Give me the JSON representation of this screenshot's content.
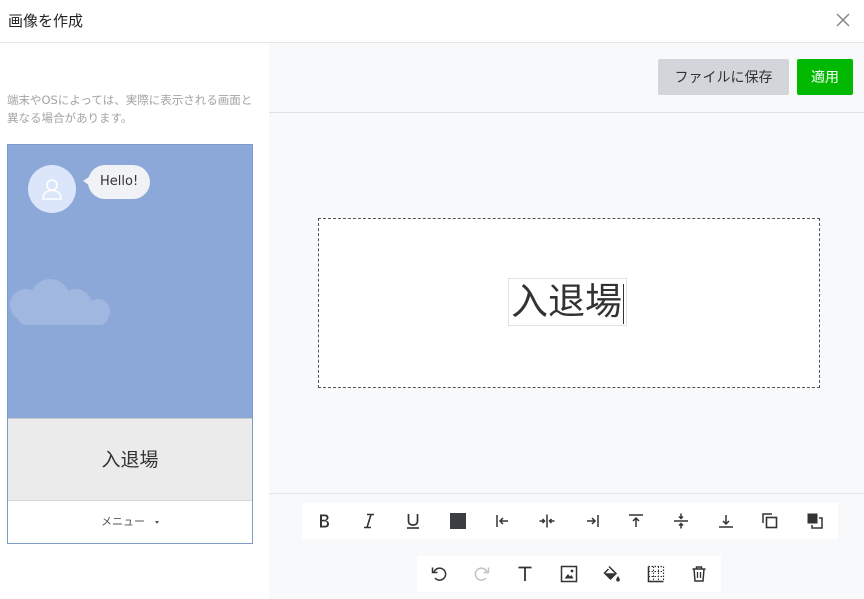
{
  "dialog": {
    "title": "画像を作成"
  },
  "preview": {
    "notice": "端末やOSによっては、実際に表示される画面と異なる場合があります。",
    "bubble_text": "Hello!",
    "richmenu_label": "入退場",
    "menu_label": "メニュー"
  },
  "actions": {
    "save_label": "ファイルに保存",
    "apply_label": "適用"
  },
  "editor": {
    "text": "入退場"
  },
  "colors": {
    "apply": "#00b900",
    "chat_background": "#8ba8d8",
    "swatch": "#3a3d44"
  },
  "toolbar": {
    "row1": [
      "bold-icon",
      "italic-icon",
      "underline-icon",
      "text-color-icon",
      "align-left-icon",
      "align-center-icon",
      "align-right-icon",
      "align-top-icon",
      "align-middle-icon",
      "align-bottom-icon",
      "bring-forward-icon",
      "send-backward-icon"
    ],
    "row2": [
      "undo-icon",
      "redo-icon",
      "add-text-icon",
      "add-image-icon",
      "fill-color-icon",
      "grid-icon",
      "delete-icon"
    ]
  }
}
